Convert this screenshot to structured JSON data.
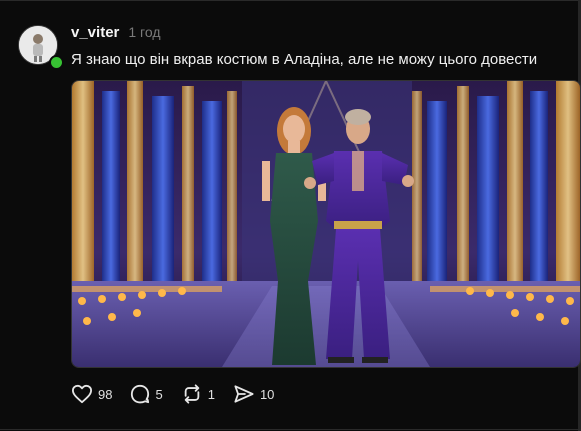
{
  "post": {
    "username": "v_viter",
    "time": "1 год",
    "text": "Я знаю що він вкрав костюм в Аладіна, але не можу цього довести"
  },
  "actions": {
    "likes": "98",
    "comments": "5",
    "reposts": "1",
    "shares": "10"
  },
  "icons": {
    "like": "heart-icon",
    "comment": "comment-icon",
    "repost": "repost-icon",
    "share": "send-icon"
  },
  "colors": {
    "online": "#37c233",
    "background": "#0b0b0b"
  }
}
